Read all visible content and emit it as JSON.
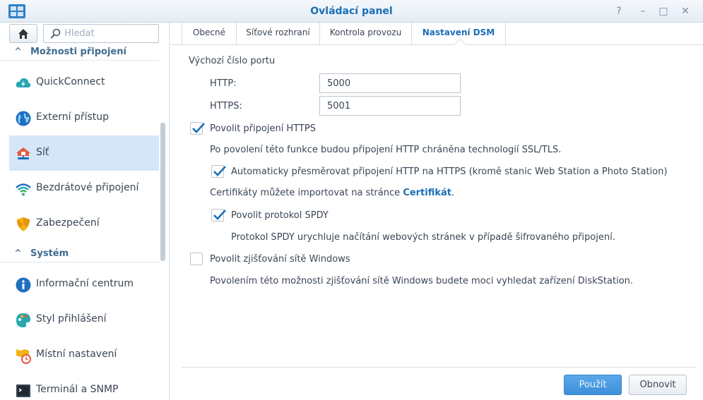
{
  "window": {
    "title": "Ovládací panel",
    "help_glyph": "?",
    "minimize_glyph": "–",
    "maximize_glyph": "□",
    "close_glyph": "✕"
  },
  "sidebar": {
    "search_placeholder": "Hledat",
    "sections": [
      {
        "label": "Možnosti připojení",
        "items": [
          {
            "label": "QuickConnect",
            "icon": "quickconnect-icon"
          },
          {
            "label": "Externí přístup",
            "icon": "globe-icon"
          },
          {
            "label": "Síť",
            "icon": "network-house-icon",
            "active": true
          },
          {
            "label": "Bezdrátové připojení",
            "icon": "wifi-icon"
          },
          {
            "label": "Zabezpečení",
            "icon": "shield-icon"
          }
        ]
      },
      {
        "label": "Systém",
        "items": [
          {
            "label": "Informační centrum",
            "icon": "info-icon"
          },
          {
            "label": "Styl přihlášení",
            "icon": "palette-icon"
          },
          {
            "label": "Místní nastavení",
            "icon": "regional-clock-icon"
          },
          {
            "label": "Terminál a SNMP",
            "icon": "terminal-icon"
          }
        ]
      }
    ]
  },
  "tabs": [
    {
      "label": "Obecné"
    },
    {
      "label": "Síťové rozhraní"
    },
    {
      "label": "Kontrola provozu"
    },
    {
      "label": "Nastavení DSM",
      "active": true
    }
  ],
  "dsm": {
    "port_heading": "Výchozí číslo portu",
    "http_label": "HTTP:",
    "http_value": "5000",
    "https_label": "HTTPS:",
    "https_value": "5001",
    "enable_https": {
      "label": "Povolit připojení HTTPS",
      "checked": true
    },
    "https_desc": "Po povolení této funkce budou připojení HTTP chráněna technologií SSL/TLS.",
    "auto_redirect": {
      "label": "Automaticky přesměrovat připojení HTTP na HTTPS (kromě stanic Web Station a Photo Station)",
      "checked": true
    },
    "cert_text": "Certifikáty můžete importovat na stránce",
    "cert_link": "Certifikát",
    "cert_suffix": ".",
    "spdy": {
      "label": "Povolit protokol SPDY",
      "checked": true
    },
    "spdy_desc": "Protokol SPDY urychluje načítání webových stránek v případě šifrovaného připojení.",
    "windows_discovery": {
      "label": "Povolit zjišťování sítě Windows",
      "checked": false
    },
    "windows_desc": "Povolením této možnosti zjišťování sítě Windows budete moci vyhledat zařízení DiskStation."
  },
  "footer": {
    "apply_label": "Použít",
    "reset_label": "Obnovit"
  },
  "colors": {
    "accent": "#1a6fb5",
    "active_item_bg": "#d4e6f7",
    "apply_button": "#4a9be3"
  }
}
